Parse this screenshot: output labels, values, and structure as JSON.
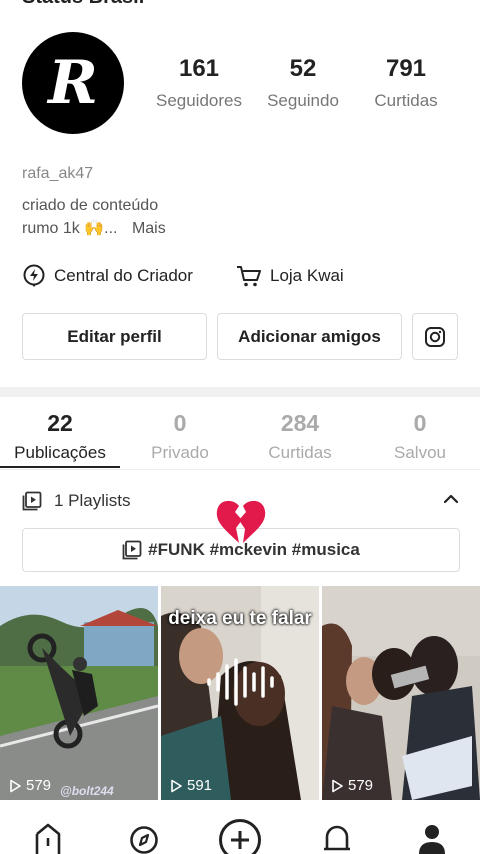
{
  "status_bar": {
    "title": "Status Brasil",
    "right_text": ""
  },
  "profile": {
    "avatar_letter": "R",
    "stats": [
      {
        "value": "161",
        "label": "Seguidores"
      },
      {
        "value": "52",
        "label": "Seguindo"
      },
      {
        "value": "791",
        "label": "Curtidas"
      }
    ],
    "username": "rafa_ak47",
    "bio_line1": "criado de conteúdo",
    "bio_line2": "rumo 1k 🙌...",
    "bio_more": "Mais"
  },
  "links": {
    "creator_center": "Central do Criador",
    "kwai_shop": "Loja Kwai"
  },
  "buttons": {
    "edit_profile": "Editar perfil",
    "add_friends": "Adicionar amigos"
  },
  "tabs": [
    {
      "count": "22",
      "label": "Publicações"
    },
    {
      "count": "0",
      "label": "Privado"
    },
    {
      "count": "284",
      "label": "Curtidas"
    },
    {
      "count": "0",
      "label": "Salvou"
    }
  ],
  "playlists": {
    "label": "1 Playlists",
    "tag_text": "#FUNK #mckevin #musica"
  },
  "videos": [
    {
      "views": "579",
      "watermark": "@bolt244"
    },
    {
      "views": "591",
      "caption": "deixa eu te falar"
    },
    {
      "views": "579"
    }
  ],
  "colors": {
    "text_primary": "#222222",
    "text_secondary": "#777777",
    "heart": "#e21a4b",
    "divider": "#f0f0f0"
  },
  "icons": {
    "nav": [
      "home-icon",
      "discover-icon",
      "create-plus-icon",
      "notifications-bell-icon",
      "profile-icon"
    ],
    "links": [
      "creator-bolt-icon",
      "shopping-cart-icon"
    ],
    "misc": [
      "instagram-icon",
      "playlist-icon",
      "chevron-up-icon",
      "broken-heart-icon",
      "play-icon",
      "audio-wave-icon"
    ]
  }
}
